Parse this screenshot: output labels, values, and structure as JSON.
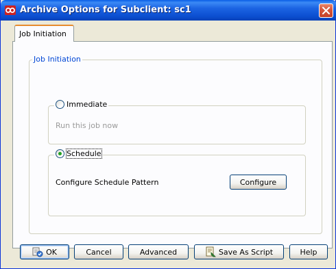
{
  "window": {
    "title": "Archive Options for Subclient: sc1"
  },
  "tabs": [
    {
      "label": "Job Initiation",
      "selected": true
    }
  ],
  "job_initiation": {
    "group_title": "Job Initiation",
    "immediate": {
      "label": "Immediate",
      "checked": false,
      "description": "Run this job now"
    },
    "schedule": {
      "label": "Schedule",
      "checked": true,
      "pattern_label": "Configure Schedule Pattern",
      "configure_button": "Configure"
    }
  },
  "footer_buttons": {
    "ok": "OK",
    "cancel": "Cancel",
    "advanced": "Advanced",
    "save_as_script": "Save As Script",
    "help": "Help"
  },
  "colors": {
    "titlebar": "#0a5ee6",
    "dialog_bg": "#ece9d8",
    "group_title": "#0046d5",
    "radio_dot": "#21a121",
    "close_button": "#d5563c"
  },
  "icons": {
    "app": "infinity-icon",
    "close": "close-icon",
    "ok": "ok-icon",
    "save_as_script": "script-icon"
  }
}
